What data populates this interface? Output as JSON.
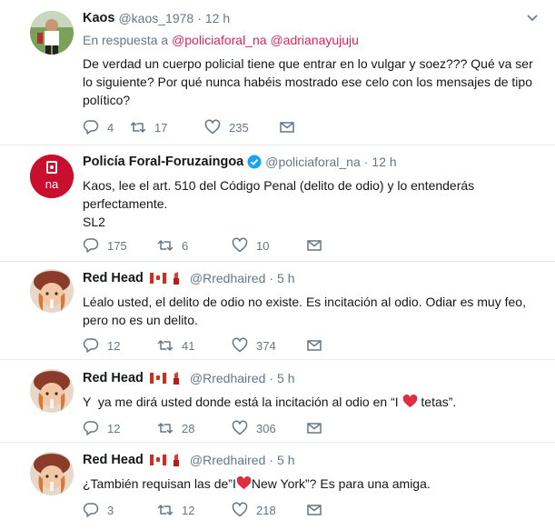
{
  "tweets": [
    {
      "name": "Kaos",
      "handle": "@kaos_1978",
      "time": "12 h",
      "reply_prefix": "En respuesta a",
      "reply_user1": "@policiaforal_na",
      "reply_user2": "@adrianayujuju",
      "text": "De verdad un cuerpo policial tiene que entrar en lo vulgar y soez??? Qué va ser lo siguiente? Por qué nunca habéis mostrado ese celo con los mensajes de tipo político?",
      "replies": "4",
      "retweets": "17",
      "likes": "235"
    },
    {
      "name": "Policía Foral-Foruzaingoa",
      "handle": "@policiaforal_na",
      "time": "12 h",
      "avatar_text": "na",
      "text": "Kaos, lee el art. 510 del Código Penal (delito de odio) y lo entenderás perfectamente.\nSL2",
      "replies": "175",
      "retweets": "6",
      "likes": "10"
    },
    {
      "name": "Red Head",
      "handle": "@Rredhaired",
      "time": "5 h",
      "text": "Léalo usted, el delito de odio no existe. Es incitación al odio. Odiar es muy feo, pero no es un delito.",
      "replies": "12",
      "retweets": "41",
      "likes": "374"
    },
    {
      "name": "Red Head",
      "handle": "@Rredhaired",
      "time": "5 h",
      "text_before": "Y  ya me dirá usted donde está la incitación al odio en “I ",
      "text_after": " tetas”.",
      "replies": "12",
      "retweets": "28",
      "likes": "306"
    },
    {
      "name": "Red Head",
      "handle": "@Rredhaired",
      "time": "5 h",
      "text_before": "¿También requisan las de”I",
      "text_after": "New York”? Es para una amiga.",
      "replies": "3",
      "retweets": "12",
      "likes": "218"
    }
  ],
  "colors": {
    "link": "#e0245e",
    "muted": "#657786",
    "verified": "#1da1f2",
    "brand_red": "#c8102e",
    "heart": "#dd2e44"
  },
  "icons": [
    "reply-icon",
    "retweet-icon",
    "like-icon",
    "dm-icon",
    "caret-down-icon",
    "verified-icon",
    "canada-flag-icon",
    "lipstick-icon",
    "heart-emoji-icon"
  ]
}
